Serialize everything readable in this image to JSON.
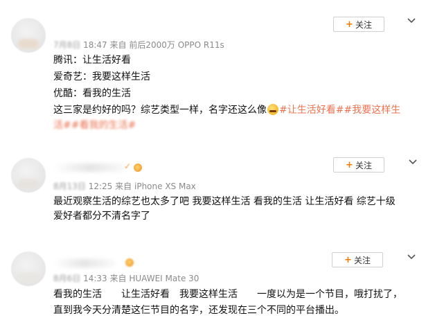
{
  "posts": [
    {
      "meta": {
        "date": "7月8日",
        "time": "18:47",
        "source_label": "来自",
        "source": "前后2000万 OPPO R11s"
      },
      "follow_label": "关注",
      "lines": [
        {
          "text": "腾讯：让生活好看"
        },
        {
          "text": "爱奇艺：我要这样生活"
        },
        {
          "text": "优酷：看我的生活"
        },
        {
          "text": "这三家是约好的吗？综艺类型一样，名字还这么像",
          "tag": "#让生活好看##我要这样生"
        },
        {
          "tag": "活##看我的生活#"
        }
      ]
    },
    {
      "meta": {
        "date": "8月13日",
        "time": "12:25",
        "source_label": "来自",
        "source": "iPhone XS Max"
      },
      "follow_label": "关注",
      "lines": [
        {
          "text": "最近观察生活的综艺也太多了吧 我要这样生活 看我的生活 让生活好看 综艺十级"
        },
        {
          "text": "爱好者都分不清名字了"
        }
      ]
    },
    {
      "meta": {
        "date": "8月6日",
        "time": "14:33",
        "source_label": "来自",
        "source": "HUAWEI Mate 30"
      },
      "follow_label": "关注",
      "lines": [
        {
          "text": "看我的生活　　让生活好看　我要这样生活　　一度以为是一个节目，哦打扰了，"
        },
        {
          "text": "直到我今天分清楚这仨节目的名字，还发现在三个不同的平台播出。"
        }
      ]
    }
  ],
  "colors": {
    "accent_plus": "#f27900",
    "hashtag": "#eb7350",
    "meta": "#8a8a8a"
  },
  "icons": {
    "follow": "plus-icon",
    "menu": "chevron-down-icon"
  }
}
